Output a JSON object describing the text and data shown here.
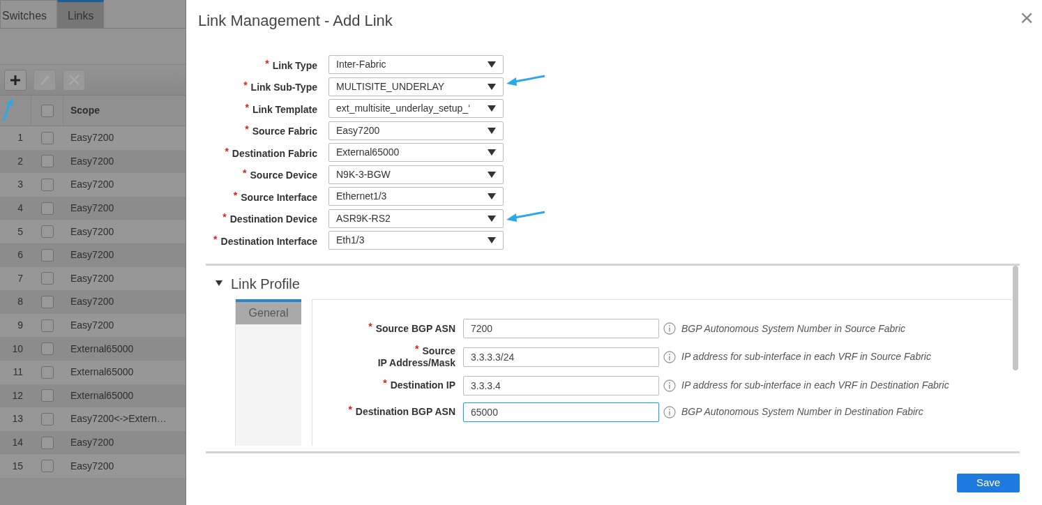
{
  "background": {
    "tabs": [
      {
        "label": "Switches",
        "selected": false
      },
      {
        "label": "Links",
        "selected": true
      }
    ],
    "toolbar": [
      {
        "kind": "add",
        "disabled": false
      },
      {
        "kind": "edit",
        "disabled": true
      },
      {
        "kind": "delete",
        "disabled": true
      }
    ],
    "table": {
      "header_checked": false,
      "scope_heading": "Scope",
      "rows": [
        {
          "number": "1",
          "checked": false,
          "scope": "Easy7200"
        },
        {
          "number": "2",
          "checked": false,
          "scope": "Easy7200"
        },
        {
          "number": "3",
          "checked": false,
          "scope": "Easy7200"
        },
        {
          "number": "4",
          "checked": false,
          "scope": "Easy7200"
        },
        {
          "number": "5",
          "checked": false,
          "scope": "Easy7200"
        },
        {
          "number": "6",
          "checked": false,
          "scope": "Easy7200"
        },
        {
          "number": "7",
          "checked": false,
          "scope": "Easy7200"
        },
        {
          "number": "8",
          "checked": false,
          "scope": "Easy7200"
        },
        {
          "number": "9",
          "checked": false,
          "scope": "Easy7200"
        },
        {
          "number": "10",
          "checked": false,
          "scope": "External65000"
        },
        {
          "number": "11",
          "checked": false,
          "scope": "External65000"
        },
        {
          "number": "12",
          "checked": false,
          "scope": "External65000"
        },
        {
          "number": "13",
          "checked": false,
          "scope": "Easy7200<->Extern…"
        },
        {
          "number": "14",
          "checked": false,
          "scope": "Easy7200"
        },
        {
          "number": "15",
          "checked": false,
          "scope": "Easy7200"
        }
      ]
    }
  },
  "annotations": [
    {
      "kind": "arrow_up"
    },
    {
      "kind": "arrow_left"
    },
    {
      "kind": "arrow_left"
    }
  ],
  "modal": {
    "title": "Link Management - Add Link",
    "close": "×",
    "fields": [
      {
        "label": "Link Type",
        "asterisk": "*",
        "value": "Inter-Fabric"
      },
      {
        "label": "Link Sub-Type",
        "asterisk": "*",
        "value": "MULTISITE_UNDERLAY"
      },
      {
        "label": "Link Template",
        "asterisk": "*",
        "value": "ext_multisite_underlay_setup_‘"
      },
      {
        "label": "Source Fabric",
        "asterisk": "*",
        "value": "Easy7200"
      },
      {
        "label": "Destination Fabric",
        "asterisk": "*",
        "value": "External65000"
      },
      {
        "label": "Source Device",
        "asterisk": "*",
        "value": "N9K-3-BGW"
      },
      {
        "label": "Source Interface",
        "asterisk": "*",
        "value": "Ethernet1/3"
      },
      {
        "label": "Destination Device",
        "asterisk": "*",
        "value": "ASR9K-RS2"
      },
      {
        "label": "Destination Interface",
        "asterisk": "*",
        "value": "Eth1/3"
      }
    ],
    "link_profile": {
      "title": "Link Profile",
      "expanded": true,
      "tabs": [
        {
          "label": "General",
          "selected": true
        }
      ],
      "fields": [
        {
          "label": "Source BGP ASN",
          "asterisk": "*",
          "value": "7200",
          "focused": false,
          "help": "BGP Autonomous System Number in Source Fabric"
        },
        {
          "label": "Source\nIP Address/Mask",
          "asterisk": "*",
          "value": "3.3.3.3/24",
          "focused": false,
          "help": "IP address for sub-interface in each VRF in Source Fabric"
        },
        {
          "label": "Destination IP",
          "asterisk": "*",
          "value": "3.3.3.4",
          "focused": false,
          "help": "IP address for sub-interface in each VRF in Destination Fabric"
        },
        {
          "label": "Destination BGP ASN",
          "asterisk": "*",
          "value": "65000",
          "focused": true,
          "help": "BGP Autonomous System Number in Destination Fabirc"
        }
      ]
    },
    "save": "Save"
  }
}
